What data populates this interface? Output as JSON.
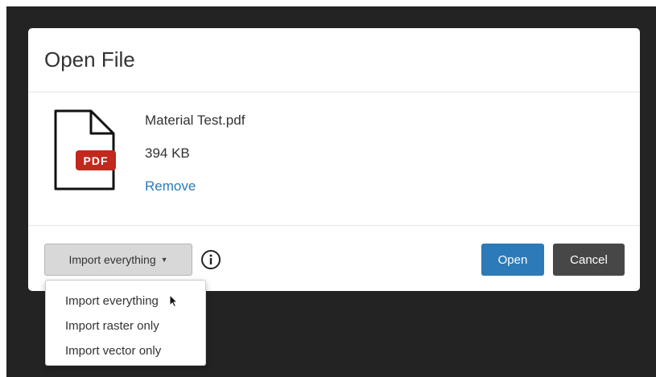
{
  "dialog": {
    "title": "Open File"
  },
  "file": {
    "icon_name": "pdf-file-icon",
    "badge_text": "PDF",
    "badge_color": "#c2281c",
    "name": "Material Test.pdf",
    "size": "394 KB",
    "remove_label": "Remove",
    "link_color": "#2a7ab7"
  },
  "footer": {
    "import_select": {
      "selected": "Import everything",
      "options": [
        "Import everything",
        "Import raster only",
        "Import vector only"
      ]
    },
    "info_icon": "info-circle-icon",
    "open_label": "Open",
    "cancel_label": "Cancel",
    "open_color": "#2d7ab8",
    "cancel_color": "#474747"
  }
}
